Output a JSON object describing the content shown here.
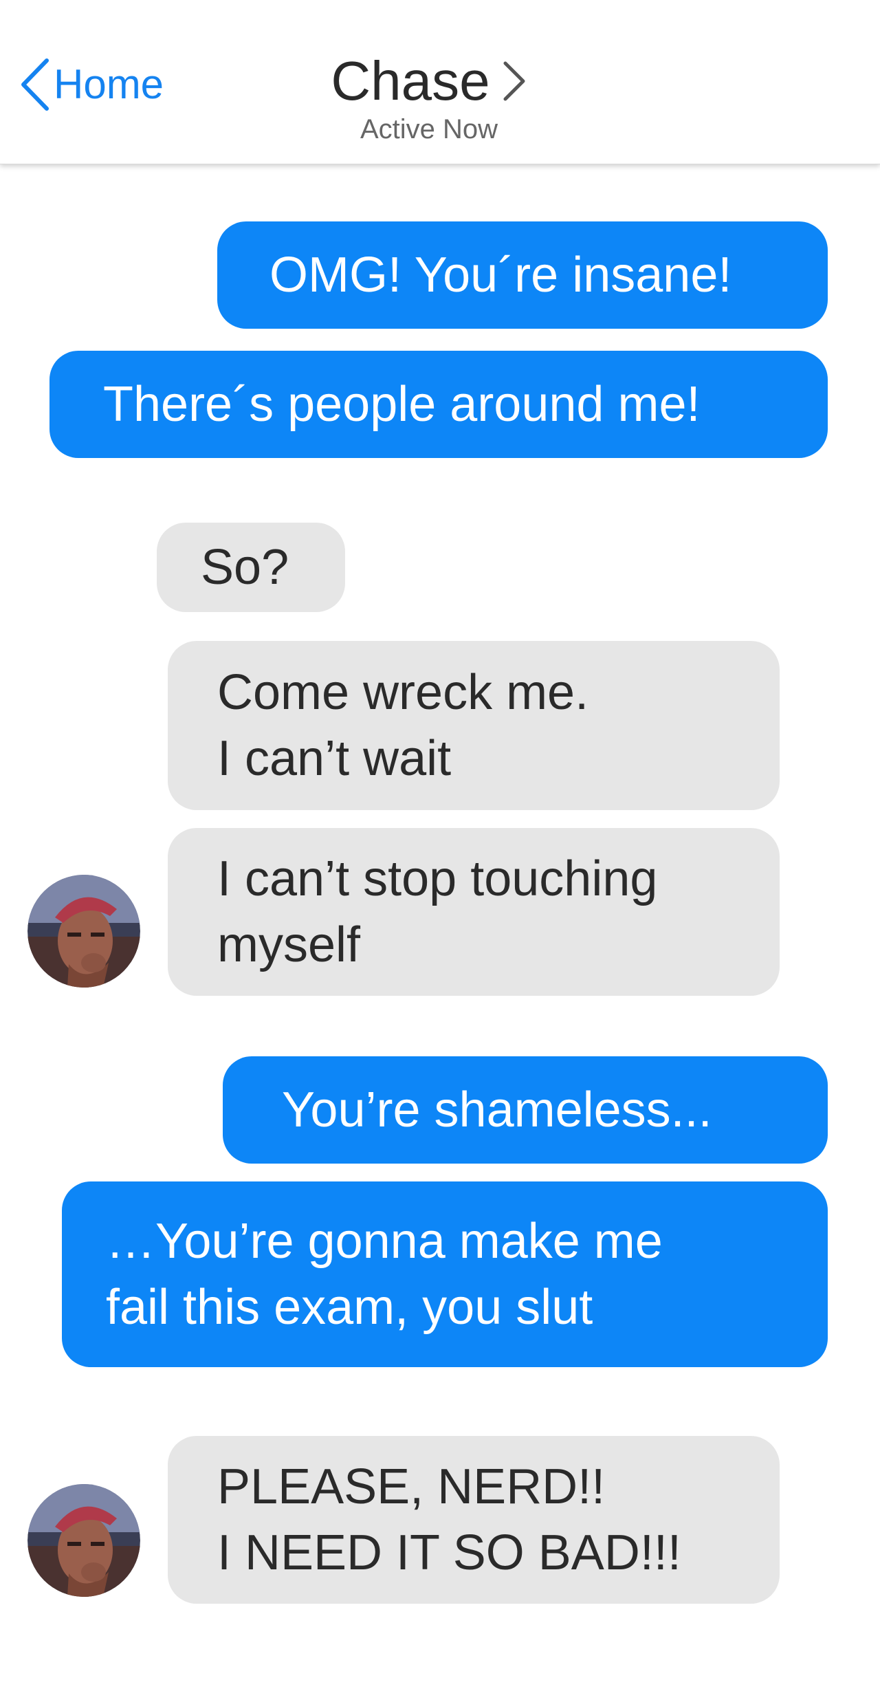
{
  "header": {
    "back_label": "Home",
    "contact_name": "Chase",
    "status": "Active Now"
  },
  "colors": {
    "accent": "#1583f0",
    "outgoing_bubble": "#0d86f7",
    "incoming_bubble": "#e6e6e6"
  },
  "messages": [
    {
      "direction": "outgoing",
      "lines": [
        "OMG! You´re insane!"
      ]
    },
    {
      "direction": "outgoing",
      "lines": [
        "There´s people around me!"
      ]
    },
    {
      "direction": "incoming",
      "lines": [
        "So?"
      ]
    },
    {
      "direction": "incoming",
      "lines": [
        "Come wreck me.",
        "I can’t wait"
      ]
    },
    {
      "direction": "incoming",
      "lines": [
        "I can’t stop touching",
        "myself"
      ]
    },
    {
      "direction": "outgoing",
      "lines": [
        "You’re shameless..."
      ]
    },
    {
      "direction": "outgoing",
      "lines": [
        "…You’re gonna make me",
        "fail this exam, you slut"
      ]
    },
    {
      "direction": "incoming",
      "lines": [
        "PLEASE, NERD!!",
        "I NEED IT SO BAD!!!"
      ]
    }
  ],
  "icons": {
    "back": "chevron-left-icon",
    "contact_details": "chevron-right-icon",
    "avatar": "contact-avatar"
  }
}
